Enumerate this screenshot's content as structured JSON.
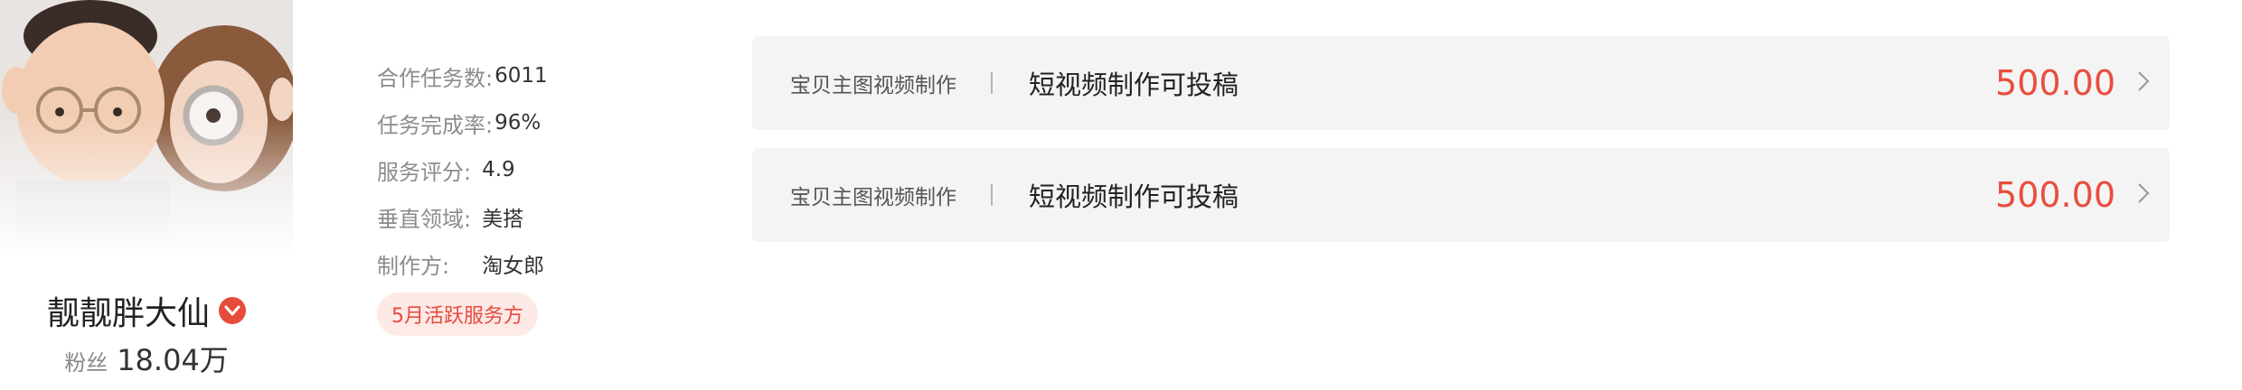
{
  "profile": {
    "name": "靓靓胖大仙",
    "fans_label": "粉丝",
    "fans_count": "18.04万",
    "verified_icon": "verified-v-icon",
    "colors": {
      "accent": "#e64b3c"
    }
  },
  "stats": [
    {
      "label": "合作任务数:",
      "value": "6011"
    },
    {
      "label": "任务完成率:",
      "value": "96%"
    },
    {
      "label": "服务评分:",
      "value": "4.9"
    },
    {
      "label": "垂直领域:",
      "value": "美搭"
    },
    {
      "label": "制作方:",
      "value": "淘女郎"
    }
  ],
  "badge": {
    "text": "5月活跃服务方"
  },
  "orders": [
    {
      "category": "宝贝主图视频制作",
      "title": "短视频制作可投稿",
      "price": "500.00"
    },
    {
      "category": "宝贝主图视频制作",
      "title": "短视频制作可投稿",
      "price": "500.00"
    }
  ],
  "colors": {
    "price": "#ea4d3c",
    "row_bg": "#f4f4f4",
    "badge_bg": "#fde9e6"
  }
}
